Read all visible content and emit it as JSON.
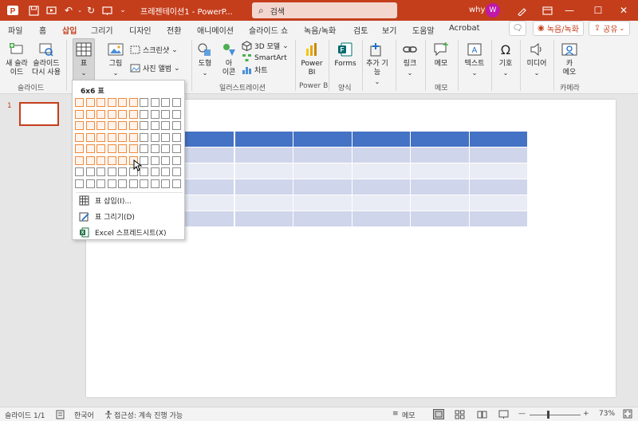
{
  "titlebar": {
    "doc_title": "프레젠테이션1 - PowerP...",
    "search_placeholder": "검색",
    "user_name": "why",
    "user_initial": "W"
  },
  "tabs": [
    {
      "label": "파일"
    },
    {
      "label": "홈"
    },
    {
      "label": "삽입"
    },
    {
      "label": "그리기"
    },
    {
      "label": "디자인"
    },
    {
      "label": "전환"
    },
    {
      "label": "애니메이션"
    },
    {
      "label": "슬라이드 쇼"
    },
    {
      "label": "녹음/녹화"
    },
    {
      "label": "검토"
    },
    {
      "label": "보기"
    },
    {
      "label": "도움말"
    },
    {
      "label": "Acrobat"
    }
  ],
  "tab_right": {
    "record": "녹음/녹화",
    "share": "공유"
  },
  "ribbon": {
    "new_slide": "새 슬라\n이드",
    "reuse_slides": "슬라이드\n다시 사용",
    "table": "표",
    "images": "그림",
    "screenshot": "스크린샷",
    "photo_album": "사진 앨범",
    "shapes": "도형",
    "icons": "아\n이콘",
    "models_3d": "3D 모델",
    "smartart": "SmartArt",
    "chart": "차트",
    "powerbi": "Power\nBI",
    "forms": "Forms",
    "addins": "추가 기\n능",
    "links": "링크",
    "comment": "메모",
    "text": "텍스트",
    "symbols": "기호",
    "media": "미디어",
    "cameo": "카\n메오",
    "groups": {
      "slides": "슬라이드",
      "illustrations": "일러스트레이션",
      "powerbi": "Power BI",
      "forms": "양식",
      "comments": "메모",
      "camera": "카메라"
    }
  },
  "thumbnail": {
    "number": "1"
  },
  "dropdown": {
    "title": "6x6 표",
    "insert_table": "표 삽입(I)...",
    "draw_table": "표 그리기(D)",
    "excel_sheet": "Excel 스프레드시트(X)"
  },
  "statusbar": {
    "slide_info": "슬라이드 1/1",
    "language": "한국어",
    "accessibility": "접근성: 계속 진행 가능",
    "notes": "메모",
    "zoom": "73%"
  },
  "colors": {
    "accent": "#c43e1c",
    "table_header": "#4472c4",
    "table_band_dark": "#cfd5ea",
    "table_band_light": "#e9ebf5",
    "grid_highlight": "#f08a3c"
  }
}
